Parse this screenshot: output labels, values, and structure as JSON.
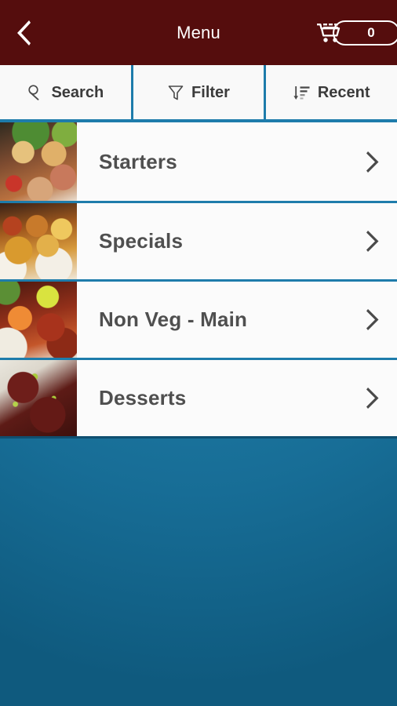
{
  "header": {
    "title": "Menu",
    "back_icon": "back-chevron-icon",
    "cart_icon": "shopping-cart-icon",
    "cart_count": "0",
    "background_color": "#550d0d"
  },
  "toolbar": {
    "tabs": [
      {
        "label": "Search",
        "icon": "search-icon"
      },
      {
        "label": "Filter",
        "icon": "filter-funnel-icon"
      },
      {
        "label": "Recent",
        "icon": "sort-descending-icon"
      }
    ]
  },
  "menu": {
    "chevron_icon": "chevron-right-icon",
    "categories": [
      {
        "name": "Starters",
        "thumb_alt": "grilled-meat-platter-photo"
      },
      {
        "name": "Specials",
        "thumb_alt": "curry-with-peppers-photo"
      },
      {
        "name": "Non Veg - Main",
        "thumb_alt": "tandoori-chicken-with-lemon-photo"
      },
      {
        "name": "Desserts",
        "thumb_alt": "gulab-jamun-dessert-photo"
      }
    ]
  },
  "colors": {
    "header": "#550d0d",
    "divider_blue": "#1e7cab",
    "page_background": "#1f7ba4",
    "row_background": "#fbfbfb",
    "text_gray": "#4f4f4f"
  }
}
